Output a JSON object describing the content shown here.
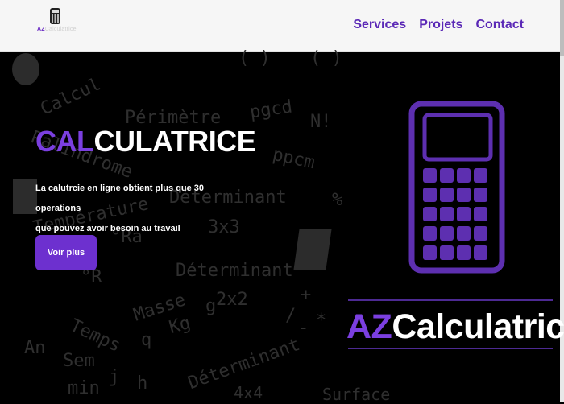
{
  "header": {
    "logo": {
      "prefix": "AZ",
      "z_letter": "",
      "rest": "Calculatrice"
    },
    "nav": [
      "Services",
      "Projets",
      "Contact"
    ]
  },
  "background_words": [
    "Calcul",
    "Périmètre",
    "pgcd",
    "N!",
    "Palindrome",
    "ppcm",
    "Déterminant",
    "%",
    "3x3",
    "Température",
    "°Ra",
    "°R",
    "Déterminant",
    "Masse",
    "g",
    "Kg",
    "q",
    "2x2",
    "Temps",
    "An",
    "Sem",
    "j",
    "h",
    "min",
    "Déterminant",
    "4x4",
    "Surface",
    "( )",
    "( )",
    "+",
    "/",
    "-",
    "*"
  ],
  "hero": {
    "title_accent": "CAL",
    "title_rest": "CULATRICE",
    "desc_line1": "La calutrcie en ligne obtient plus que 30 operations",
    "desc_line2": "que pouvez avoir besoin au travail",
    "button": "Voir plus"
  },
  "brand": {
    "accent": "AZ",
    "rest": "Calculatrice"
  },
  "colors": {
    "accent": "#7b3fe0",
    "nav": "#5a28b6",
    "background": "#000000",
    "header": "#f6f6f6"
  }
}
